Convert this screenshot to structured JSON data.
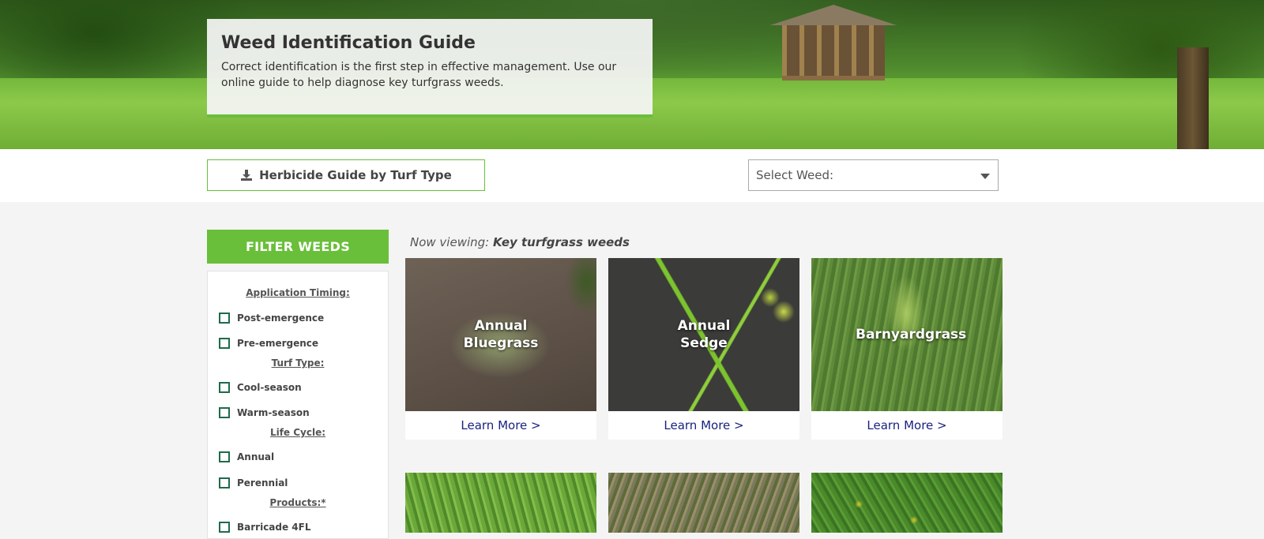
{
  "hero": {
    "title": "Weed Identification Guide",
    "description": "Correct identification is the first step in effective management. Use our online guide to help diagnose key turfgrass weeds."
  },
  "toolbar": {
    "guide_button_label": "Herbicide Guide by Turf Type",
    "guide_button_icon": "download-icon",
    "select_weed_value": "Select Weed:"
  },
  "filter": {
    "header": "FILTER WEEDS",
    "groups": [
      {
        "heading": "Application Timing:",
        "options": [
          "Post-emergence",
          "Pre-emergence"
        ]
      },
      {
        "heading": "Turf Type:",
        "options": [
          "Cool-season",
          "Warm-season"
        ]
      },
      {
        "heading": "Life Cycle:",
        "options": [
          "Annual",
          "Perennial"
        ]
      },
      {
        "heading": "Products:*",
        "options": [
          "Barricade 4FL"
        ]
      }
    ]
  },
  "main": {
    "now_viewing_prefix": "Now viewing:",
    "now_viewing_value": "Key turfgrass weeds",
    "weeds": [
      {
        "name": "Annual Bluegrass",
        "link": "Learn More >"
      },
      {
        "name": "Annual Sedge",
        "link": "Learn More >"
      },
      {
        "name": "Barnyardgrass",
        "link": "Learn More >"
      }
    ]
  },
  "colors": {
    "accent_green": "#6abf3a",
    "checkbox_border": "#1f6b4a",
    "link_navy": "#1a237e"
  }
}
